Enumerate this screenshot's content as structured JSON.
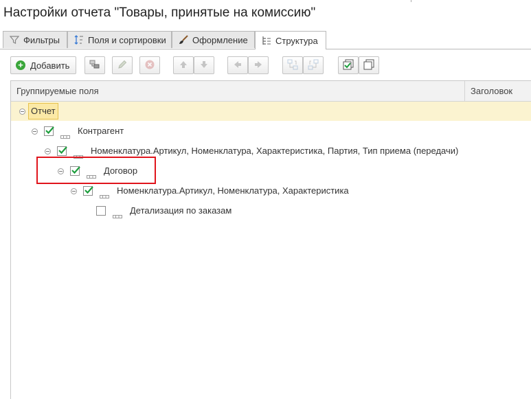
{
  "window": {
    "title": "Настройки отчета \"Товары, принятые на комиссию\""
  },
  "tabs": [
    {
      "label": "Фильтры",
      "icon": "filter-icon"
    },
    {
      "label": "Поля и сортировки",
      "icon": "sort-fields-icon"
    },
    {
      "label": "Оформление",
      "icon": "brush-icon"
    },
    {
      "label": "Структура",
      "icon": "structure-icon",
      "active": true
    }
  ],
  "toolbar": {
    "add_label": "Добавить",
    "icons": [
      "add-icon",
      "group-icon",
      "edit-icon",
      "delete-icon",
      "move-up-icon",
      "move-down-icon",
      "move-left-icon",
      "move-right-icon",
      "copy-grouping-icon",
      "paste-grouping-icon",
      "check-all-icon",
      "uncheck-all-icon"
    ]
  },
  "grid": {
    "columns": [
      "Группируемые поля",
      "Заголовок"
    ],
    "rows": [
      {
        "label": "Отчет",
        "level": 0,
        "selected": true
      },
      {
        "label": "Контрагент",
        "level": 1,
        "checked": true
      },
      {
        "label": "Номенклатура.Артикул, Номенклатура, Характеристика, Партия, Тип приема (передачи)",
        "level": 2,
        "checked": true
      },
      {
        "label": "Договор",
        "level": 3,
        "checked": true,
        "highlighted": true
      },
      {
        "label": "Номенклатура.Артикул, Номенклатура, Характеристика",
        "level": 4,
        "checked": true
      },
      {
        "label": "Детализация по заказам",
        "level": 5,
        "checked": false
      }
    ]
  },
  "colors": {
    "check": "#1e9e3e",
    "highlight_border": "#e0141c",
    "selected_row": "#fbf3d0",
    "root_label_bg": "#fbe9a6"
  }
}
